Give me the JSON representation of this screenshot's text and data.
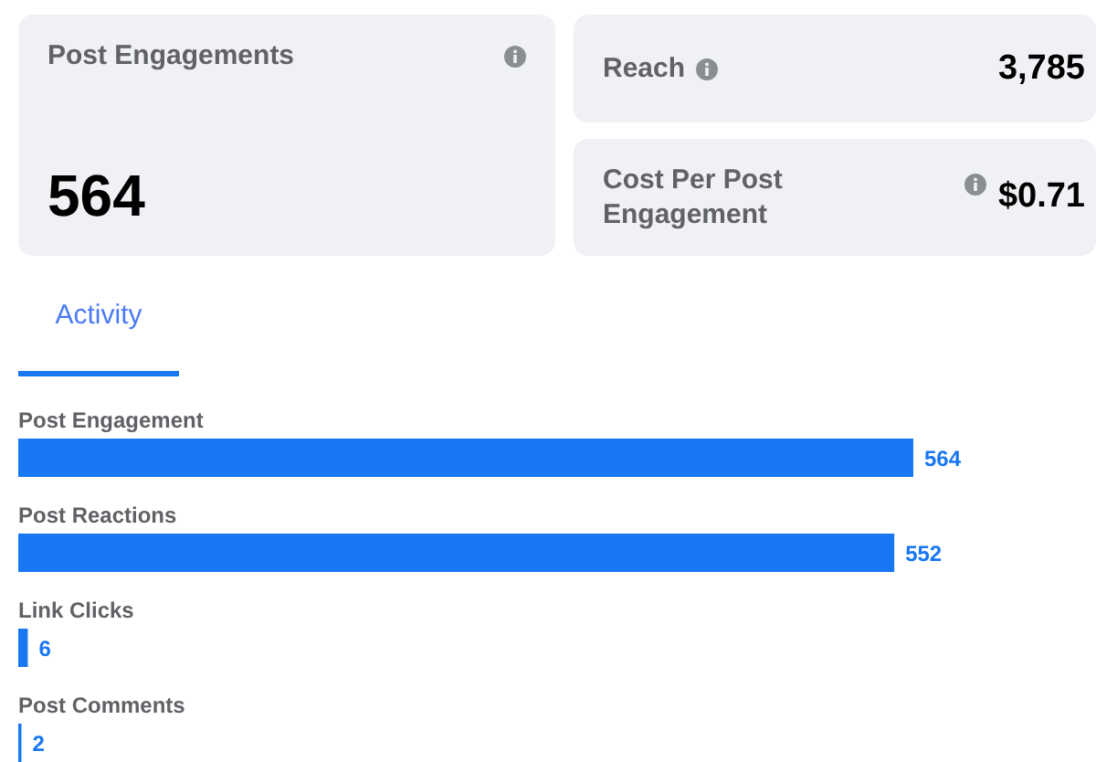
{
  "cards": [
    {
      "label": "Post Engagements",
      "value": "564"
    },
    {
      "label": "Reach",
      "value": "3,785"
    },
    {
      "label": "Cost Per Post Engagement",
      "value": "$0.71"
    }
  ],
  "tabs": [
    {
      "label": "Activity",
      "selected": true
    }
  ],
  "activity": {
    "chart_data": {
      "type": "bar",
      "orientation": "horizontal",
      "data_labels": true,
      "categories": [
        "Post Engagement",
        "Post Reactions",
        "Link Clicks",
        "Post Comments"
      ],
      "values": [
        564,
        552,
        6,
        2
      ]
    }
  }
}
